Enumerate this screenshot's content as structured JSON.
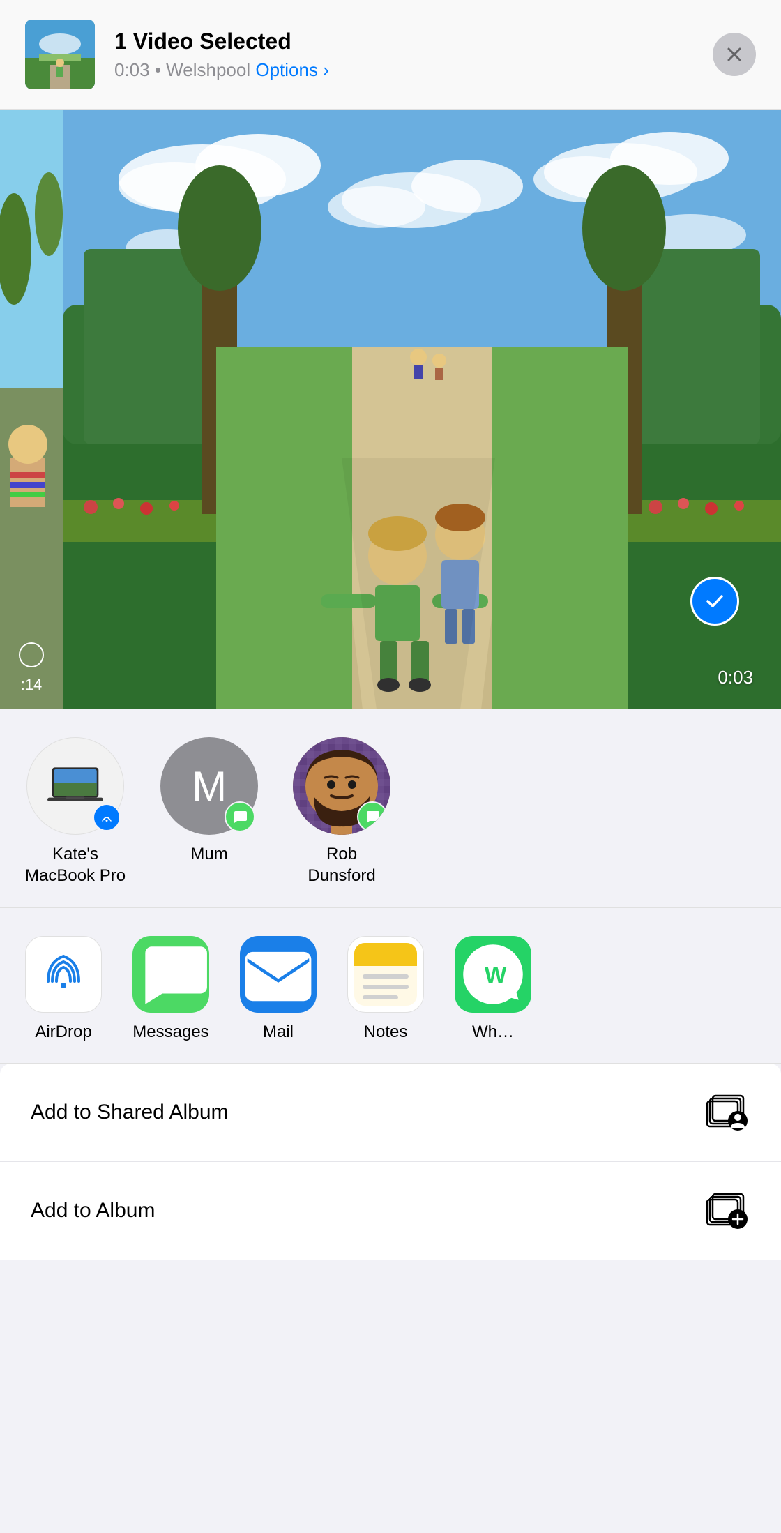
{
  "header": {
    "title": "1 Video Selected",
    "duration": "0:03",
    "location": "Welshpool",
    "options_label": "Options",
    "chevron": "›",
    "close_label": "✕"
  },
  "photo": {
    "side_label": ":14",
    "duration_label": "0:03"
  },
  "people": [
    {
      "id": "kates-macbook",
      "name": "Kate's\nMacBook Pro",
      "type": "device",
      "badge": "airdrop"
    },
    {
      "id": "mum",
      "name": "Mum",
      "type": "initial",
      "initial": "M",
      "badge": "message"
    },
    {
      "id": "rob",
      "name": "Rob\nDunsford",
      "type": "photo",
      "badge": "message"
    }
  ],
  "apps": [
    {
      "id": "airdrop",
      "label": "AirDrop",
      "icon": "airdrop"
    },
    {
      "id": "messages",
      "label": "Messages",
      "icon": "messages"
    },
    {
      "id": "mail",
      "label": "Mail",
      "icon": "mail"
    },
    {
      "id": "notes",
      "label": "Notes",
      "icon": "notes"
    },
    {
      "id": "whatsapp",
      "label": "Wh…",
      "icon": "whatsapp"
    }
  ],
  "actions": [
    {
      "id": "add-shared-album",
      "label": "Add to Shared Album",
      "icon": "shared-album"
    },
    {
      "id": "add-album",
      "label": "Add to Album",
      "icon": "add-album"
    }
  ]
}
